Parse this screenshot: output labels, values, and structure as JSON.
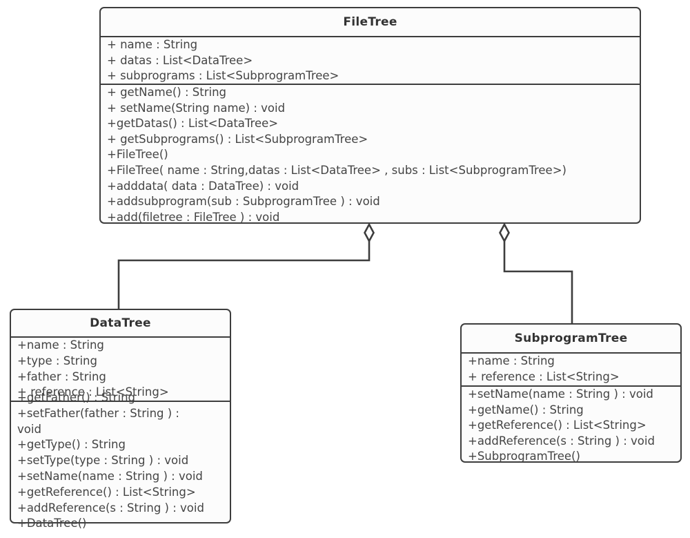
{
  "diagram": {
    "kind": "uml-class-diagram",
    "background_color": "#ffffff",
    "line_color": "#3d3d3d",
    "box_fill_color": "#fcfcfc",
    "text_color": "#444444"
  },
  "classes": [
    {
      "id": "filetree",
      "name": "FileTree",
      "attributes": [
        "+ name : String",
        "+ datas : List<DataTree>",
        "+ subprograms : List<SubprogramTree>"
      ],
      "operations": [
        "+ getName() : String",
        "+ setName(String name) : void",
        "+getDatas() : List<DataTree>",
        "+ getSubprograms() : List<SubprogramTree>",
        "+FileTree()",
        "+FileTree( name : String,datas : List<DataTree> , subs : List<SubprogramTree>)",
        "+adddata( data : DataTree) : void",
        "+addsubprogram(sub : SubprogramTree ) : void",
        "+add(filetree : FileTree ) : void"
      ]
    },
    {
      "id": "datatree",
      "name": "DataTree",
      "attributes": [
        "+name : String",
        "+type : String",
        "+father : String",
        "+ reference : List<String>"
      ],
      "operations": [
        "+getFather() : String",
        "+setFather(father : String ) :",
        "void",
        "+getType() : String",
        "+setType(type : String ) : void",
        "+setName(name : String ) : void",
        "+getReference() : List<String>",
        "+addReference(s : String ) : void",
        "+DataTree()"
      ]
    },
    {
      "id": "subprogramtree",
      "name": "SubprogramTree",
      "attributes": [
        "+name : String",
        "+ reference : List<String>"
      ],
      "operations": [
        "+setName(name : String ) : void",
        "+getName() : String",
        "+getReference() : List<String>",
        "+addReference(s : String ) : void",
        "+SubprogramTree()"
      ]
    }
  ],
  "relationships": [
    {
      "id": "filetree-datatree",
      "type": "aggregation",
      "marker": "hollow-diamond",
      "source": "FileTree",
      "target": "DataTree",
      "label": ""
    },
    {
      "id": "filetree-subprogramtree",
      "type": "aggregation",
      "marker": "hollow-diamond",
      "source": "FileTree",
      "target": "SubprogramTree",
      "label": ""
    }
  ]
}
